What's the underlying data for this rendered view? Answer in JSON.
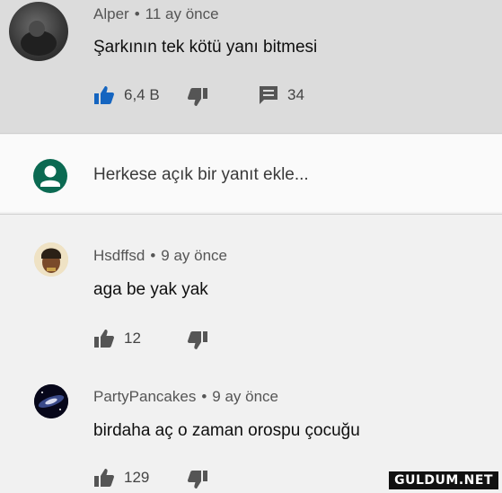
{
  "comments": [
    {
      "author": "Alper",
      "age": "11 ay önce",
      "text": "Şarkının tek kötü yanı bitmesi",
      "likes": "6,4 B",
      "replies": "34"
    },
    {
      "author": "Hsdffsd",
      "age": "9 ay önce",
      "text": "aga be yak yak",
      "likes": "12"
    },
    {
      "author": "PartyPancakes",
      "age": "9 ay önce",
      "text": "birdaha aç o zaman orospu çocuğu",
      "likes": "129"
    }
  ],
  "reply_box": {
    "placeholder": "Herkese açık bir yanıt ekle..."
  },
  "meta_separator": "•",
  "watermark": "GULDUM.NET",
  "colors": {
    "like_active": "#1565c0",
    "icon_gray": "#555555",
    "reply_avatar": "#0b6a52",
    "highlight_bg": "#dcdcdc"
  }
}
